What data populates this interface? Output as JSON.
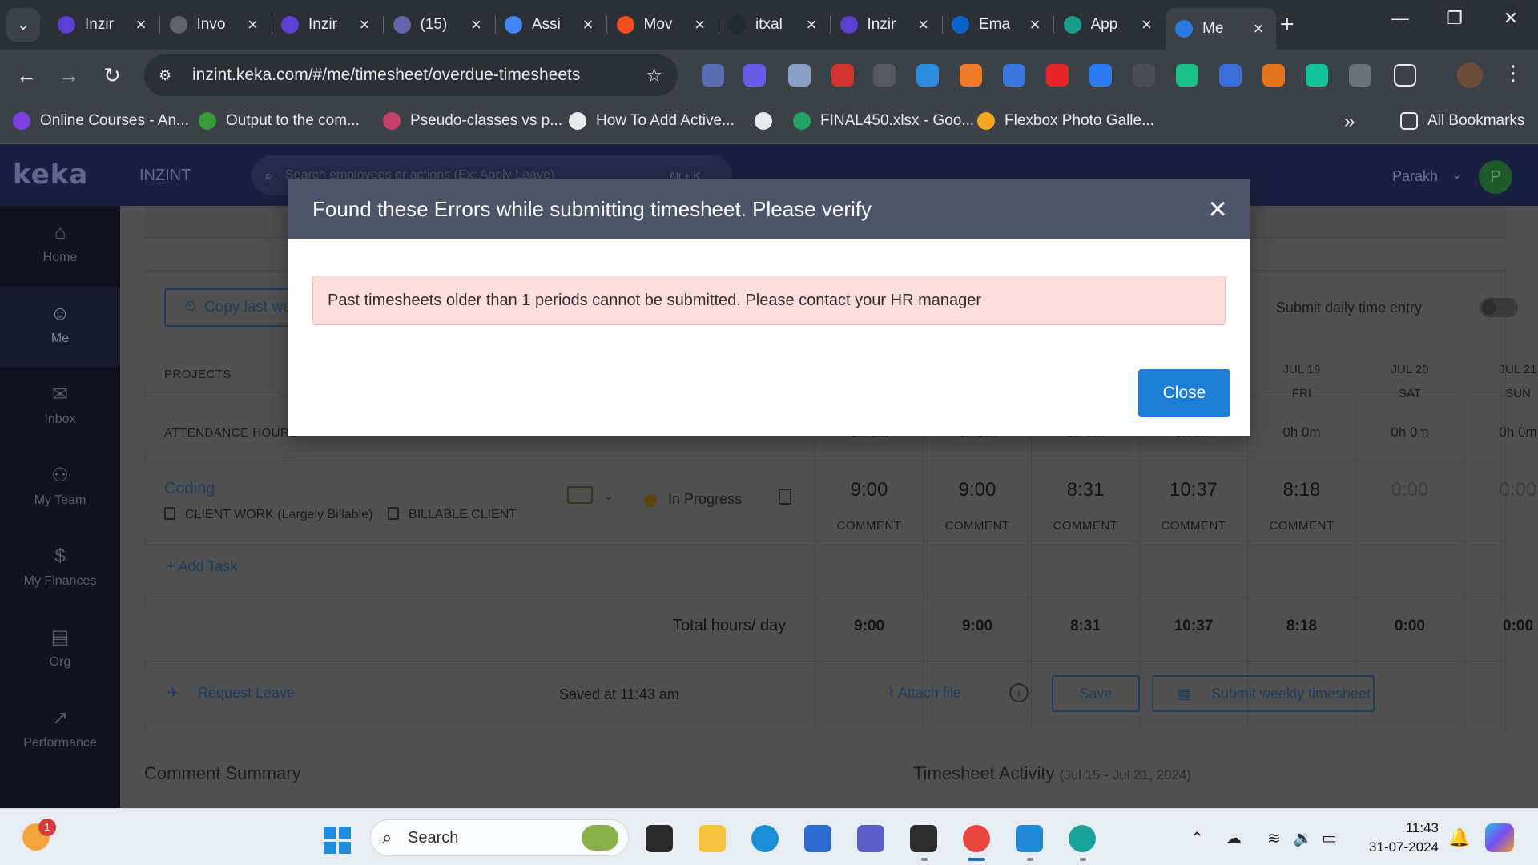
{
  "browser": {
    "tabs": [
      {
        "label": "Inzir",
        "favicon": "keka-purple-icon",
        "color": "#5b3fd0"
      },
      {
        "label": "Invo",
        "favicon": "globe-icon",
        "color": "#5f6368"
      },
      {
        "label": "Inzir",
        "favicon": "keka-purple-icon",
        "color": "#5b3fd0"
      },
      {
        "label": "(15)",
        "favicon": "teams-icon",
        "color": "#6264a7"
      },
      {
        "label": "Assi",
        "favicon": "google-docs-icon",
        "color": "#4285f4"
      },
      {
        "label": "Mov",
        "favicon": "figma-icon",
        "color": "#f24e1e"
      },
      {
        "label": "itxal",
        "favicon": "github-icon",
        "color": "#24292e"
      },
      {
        "label": "Inzir",
        "favicon": "keka-purple-icon",
        "color": "#5b3fd0"
      },
      {
        "label": "Ema",
        "favicon": "outlook-icon",
        "color": "#0a64c8"
      },
      {
        "label": "App",
        "favicon": "app-icon",
        "color": "#1a9c8c"
      },
      {
        "label": "Me",
        "favicon": "keka-k-icon",
        "color": "#2a7ae2",
        "active": true
      }
    ],
    "url": "inzint.keka.com/#/me/timesheet/overdue-timesheets",
    "bookmarks": [
      {
        "label": "Online Courses - An...",
        "color": "#7b3fe4"
      },
      {
        "label": "Output to the com...",
        "color": "#3a9a3a"
      },
      {
        "label": "Pseudo-classes vs p...",
        "color": "#c2406b"
      },
      {
        "label": "How To Add Active...",
        "color": "#e8eaed"
      },
      {
        "label": "",
        "color": "#e8eaed"
      },
      {
        "label": "FINAL450.xlsx - Goo...",
        "color": "#1fa463"
      },
      {
        "label": "Flexbox Photo Galle...",
        "color": "#f5a623"
      }
    ],
    "all_bookmarks": "All Bookmarks"
  },
  "app": {
    "logo": "keka",
    "org": "INZINT",
    "search_placeholder": "Search employees or actions (Ex: Apply Leave)",
    "search_shortcut": "Alt + K",
    "user_name": "Parakh",
    "user_initial": "P",
    "sidebar": [
      {
        "label": "Home",
        "icon": "home-icon"
      },
      {
        "label": "Me",
        "icon": "user-icon",
        "active": true
      },
      {
        "label": "Inbox",
        "icon": "inbox-icon"
      },
      {
        "label": "My Team",
        "icon": "team-icon"
      },
      {
        "label": "My Finances",
        "icon": "finance-icon"
      },
      {
        "label": "Org",
        "icon": "org-icon"
      },
      {
        "label": "Performance",
        "icon": "performance-icon"
      }
    ]
  },
  "timesheet": {
    "copy_last_week": "Copy last we",
    "submit_daily_label": "Submit daily time entry",
    "projects_label": "PROJECTS",
    "attendance_label": "ATTENDANCE HOURS",
    "days": [
      {
        "date": "",
        "dow": "",
        "attendance": "0h 0m",
        "hours": "9:00",
        "total": "9:00",
        "comment": "COMMENT"
      },
      {
        "date": "",
        "dow": "",
        "attendance": "0h 0m",
        "hours": "9:00",
        "total": "9:00",
        "comment": "COMMENT"
      },
      {
        "date": "",
        "dow": "",
        "attendance": "0h 0m",
        "hours": "8:31",
        "total": "8:31",
        "comment": "COMMENT"
      },
      {
        "date": "",
        "dow": "",
        "attendance": "0h 0m",
        "hours": "10:37",
        "total": "10:37",
        "comment": "COMMENT"
      },
      {
        "date": "JUL 19",
        "dow": "FRI",
        "attendance": "0h 0m",
        "hours": "8:18",
        "total": "8:18",
        "comment": "COMMENT"
      },
      {
        "date": "JUL 20",
        "dow": "SAT",
        "attendance": "0h 0m",
        "hours": "0:00",
        "total": "0:00",
        "comment": ""
      },
      {
        "date": "JUL 21",
        "dow": "SUN",
        "attendance": "0h 0m",
        "hours": "0:00",
        "total": "0:00",
        "comment": ""
      }
    ],
    "project": {
      "name": "Coding",
      "category": "CLIENT WORK (Largely Billable)",
      "billing": "BILLABLE CLIENT",
      "status": "In Progress"
    },
    "add_task": "+ Add Task",
    "total_label": "Total hours/ day",
    "request_leave": "Request Leave",
    "saved_at": "Saved at 11:43 am",
    "attach_file": "Attach file",
    "save": "Save",
    "submit_weekly": "Submit weekly timesheet",
    "comment_summary": "Comment Summary",
    "activity_title": "Timesheet Activity",
    "activity_range": "(Jul 15 - Jul 21, 2024)"
  },
  "modal": {
    "title": "Found these Errors while submitting timesheet. Please verify",
    "error": "Past timesheets older than 1 periods cannot be submitted. Please contact your HR manager",
    "close": "Close"
  },
  "taskbar": {
    "weather_badge": "1",
    "search": "Search",
    "time": "11:43",
    "date": "31-07-2024"
  }
}
